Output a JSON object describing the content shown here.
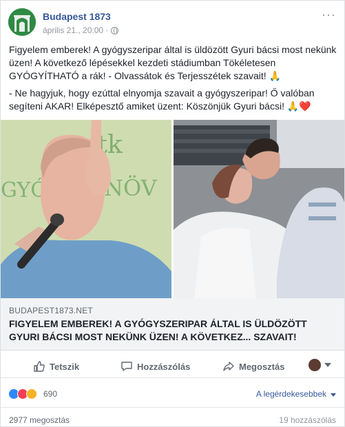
{
  "post": {
    "page_name": "Budapest 1873",
    "timestamp": "április 21., 20:00 ·",
    "paragraph1": "Figyelem emberek! A gyógyszeripar által is üldözött Gyuri bácsi most nekünk üzen! A következő lépésekkel kezdeti stádiumban Tökéletesen GYÓGYÍTHATÓ a rák! - Olvassátok és Terjesszétek szavait! 🙏",
    "paragraph2": "- Ne hagyjuk, hogy ezúttal elnyomja szavait a gyógyszeripar! Ő valóban segíteni AKAR! Elképesztő amiket üzent: Köszönjük Gyuri bácsi! 🙏❤️"
  },
  "link": {
    "domain": "BUDAPEST1873.NET",
    "title": "FIGYELEM EMBEREK! A GYÓGYSZERIPAR ÁLTAL IS ÜLDÖZÖTT GYURI BÁCSI MOST NEKÜNK ÜZEN! A KÖVETKEZ... SZAVAIT!"
  },
  "actions": {
    "like": "Tetszik",
    "comment": "Hozzászólás",
    "share": "Megosztás"
  },
  "reactions": {
    "count": "690",
    "sort_label": "A legérdekesebbek",
    "icons": [
      "like-icon",
      "love-icon",
      "wow-icon"
    ]
  },
  "stats": {
    "shares": "2977 megosztás",
    "comments": "19 hozzászólás"
  },
  "colors": {
    "link_blue": "#365899",
    "like_blue": "#2d88ff",
    "love_red": "#f33e58",
    "wow_yellow": "#f7b125"
  }
}
